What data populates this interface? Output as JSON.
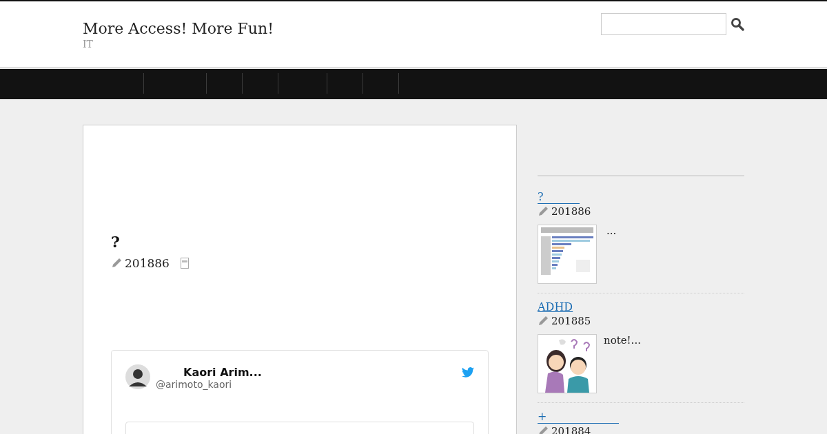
{
  "site": {
    "title": "More Access! More Fun!",
    "tagline": "IT"
  },
  "article": {
    "title": "?",
    "date": "201886"
  },
  "tweet": {
    "name": "Kaori Arim...",
    "handle": "@arimoto_kaori"
  },
  "sidebar": {
    "posts": [
      {
        "title": "?",
        "date": "201886",
        "excerpt": "..."
      },
      {
        "title": "ADHD",
        "date": "201885",
        "excerpt": "note!..."
      },
      {
        "title": "+",
        "date": "201884"
      }
    ]
  }
}
